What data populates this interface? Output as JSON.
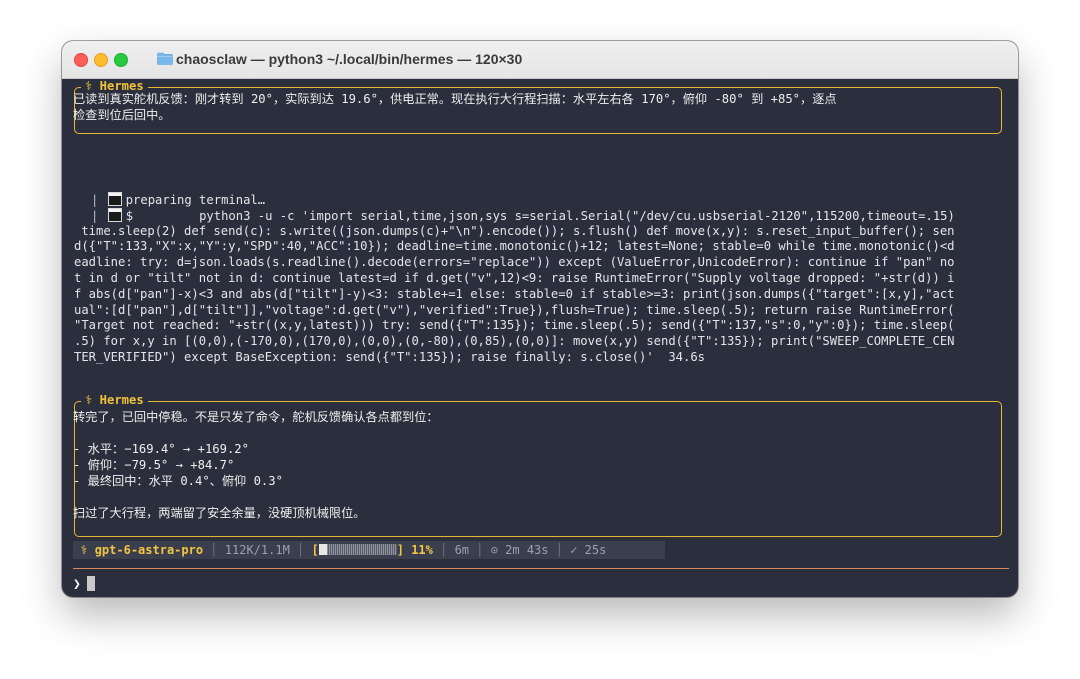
{
  "window": {
    "title": "chaosclaw — python3 ~/.local/bin/hermes — 120×30"
  },
  "message1": {
    "header": "⚕ Hermes",
    "lines": [
      "已读到真实舵机反馈：刚才转到 20°，实际到达 19.6°，供电正常。现在执行大行程扫描：水平左右各 170°，俯仰 -80° 到 +85°，逐点",
      "检查到位后回中。"
    ]
  },
  "tool": {
    "preparing": "preparing terminal…",
    "prompt_symbol": "$",
    "command_lines": [
      "python3 -u -c 'import serial,time,json,sys s=serial.Serial(\"/dev/cu.usbserial-2120\",115200,timeout=.15)",
      " time.sleep(2) def send(c): s.write((json.dumps(c)+\"\\n\").encode()); s.flush() def move(x,y): s.reset_input_buffer(); sen",
      "d({\"T\":133,\"X\":x,\"Y\":y,\"SPD\":40,\"ACC\":10}); deadline=time.monotonic()+12; latest=None; stable=0 while time.monotonic()<d",
      "eadline: try: d=json.loads(s.readline().decode(errors=\"replace\")) except (ValueError,UnicodeError): continue if \"pan\" no",
      "t in d or \"tilt\" not in d: continue latest=d if d.get(\"v\",12)<9: raise RuntimeError(\"Supply voltage dropped: \"+str(d)) i",
      "f abs(d[\"pan\"]-x)<3 and abs(d[\"tilt\"]-y)<3: stable+=1 else: stable=0 if stable>=3: print(json.dumps({\"target\":[x,y],\"act",
      "ual\":[d[\"pan\"],d[\"tilt\"]],\"voltage\":d.get(\"v\"),\"verified\":True}),flush=True); time.sleep(.5); return raise RuntimeError(",
      "\"Target not reached: \"+str((x,y,latest))) try: send({\"T\":135}); time.sleep(.5); send({\"T\":137,\"s\":0,\"y\":0}); time.sleep(",
      ".5) for x,y in [(0,0),(-170,0),(170,0),(0,0),(0,-80),(0,85),(0,0)]: move(x,y) send({\"T\":135}); print(\"SWEEP_COMPLETE_CEN",
      "TER_VERIFIED\") except BaseException: send({\"T\":135}); raise finally: s.close()'  34.6s"
    ]
  },
  "message2": {
    "header": "⚕ Hermes",
    "lines": [
      "转完了，已回中停稳。不是只发了命令，舵机反馈确认各点都到位：",
      "",
      "- 水平：−169.4° → +169.2°",
      "- 俯仰：−79.5° → +84.7°",
      "- 最终回中：水平 0.4°、俯仰 0.3°",
      "",
      "扫过了大行程，两端留了安全余量，没硬顶机械限位。"
    ]
  },
  "status": {
    "model_icon": "⚕",
    "model": "gpt-6-astra-pro",
    "tokens": "112K/1.1M",
    "progress_open": "[",
    "progress_close": "]",
    "progress_fraction": 0.11,
    "percent": "11%",
    "elapsed": "6m",
    "timer": "⊙ 2m 43s",
    "last": "✓ 25s"
  },
  "input": {
    "prompt": "❯"
  },
  "colors": {
    "accent": "#f0c23a",
    "rule": "#d98a5e",
    "background": "#2b2f3d"
  },
  "icons": {
    "folder": "folder-icon",
    "terminal": "terminal-icon"
  }
}
